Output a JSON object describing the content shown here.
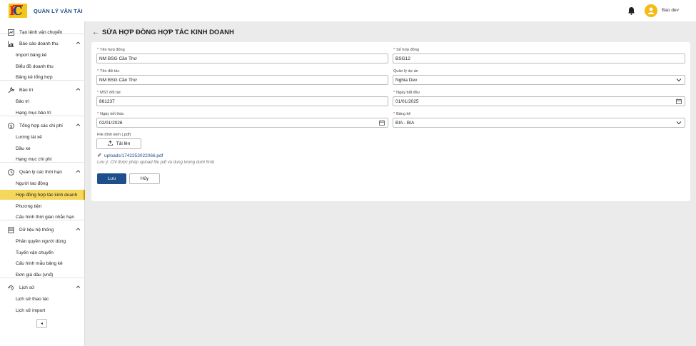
{
  "header": {
    "app_title": "QUẢN LÝ VẬN TẢI",
    "user_name": "Bao dev"
  },
  "sidebar": {
    "items": [
      {
        "type": "group",
        "label": "Tạo lệnh vận chuyển",
        "icon": "new-order-icon",
        "chevron": ""
      },
      {
        "type": "group",
        "label": "Báo cáo doanh thu",
        "icon": "bar-chart-icon",
        "chevron": "^"
      },
      {
        "type": "sub",
        "label": "Import bảng kê"
      },
      {
        "type": "sub",
        "label": "Biểu đồ doanh thu"
      },
      {
        "type": "sub",
        "label": "Bảng kê tổng hợp"
      },
      {
        "type": "group",
        "label": "Bảo trì",
        "icon": "wrench-icon",
        "chevron": "^"
      },
      {
        "type": "sub",
        "label": "Bảo trì"
      },
      {
        "type": "sub",
        "label": "Hạng mục bảo trì"
      },
      {
        "type": "group",
        "label": "Tổng hợp các chi phí",
        "icon": "dollar-icon",
        "chevron": "^"
      },
      {
        "type": "sub",
        "label": "Lương tài xế"
      },
      {
        "type": "sub",
        "label": "Dầu xe"
      },
      {
        "type": "sub",
        "label": "Hạng mục chi phí"
      },
      {
        "type": "group",
        "label": "Quản lý các thời hạn",
        "icon": "clock-icon",
        "chevron": "^"
      },
      {
        "type": "sub",
        "label": "Người lao động"
      },
      {
        "type": "sub",
        "label": "Hợp đồng hợp tác kinh doanh",
        "active": true
      },
      {
        "type": "sub",
        "label": "Phương tiện"
      },
      {
        "type": "sub",
        "label": "Cấu hình thời gian nhắc hạn"
      },
      {
        "type": "group",
        "label": "Dữ liệu hệ thống",
        "icon": "database-icon",
        "chevron": "^"
      },
      {
        "type": "sub",
        "label": "Phân quyền người dùng"
      },
      {
        "type": "sub",
        "label": "Tuyến vận chuyển"
      },
      {
        "type": "sub",
        "label": "Cấu hình mẫu bảng kê"
      },
      {
        "type": "sub",
        "label": "Đơn giá dầu (vnđ)"
      },
      {
        "type": "group",
        "label": "Lịch sử",
        "icon": "history-icon",
        "chevron": "^"
      },
      {
        "type": "sub",
        "label": "Lịch sử thao tác"
      },
      {
        "type": "sub",
        "label": "Lịch sử import"
      }
    ],
    "collapse_glyph": "◂"
  },
  "page": {
    "back_glyph": "←",
    "title": "SỬA HỢP ĐỒNG HỢP TÁC KINH DOANH"
  },
  "form": {
    "contract_name": {
      "label": "Tên hợp đồng",
      "value": "NM BSG Cần Thơ"
    },
    "contract_number": {
      "label": "Số hợp đồng",
      "value": "BSG12"
    },
    "partner_name": {
      "label": "Tên đối tác",
      "value": "NM BSG Cần Thơ"
    },
    "project_manager": {
      "label": "Quản lý dự án",
      "value": "Nghia Dev"
    },
    "partner_tax": {
      "label": "MST đối tác",
      "value": "861237"
    },
    "start_date": {
      "label": "Ngày bắt đầu",
      "value": "01/01/2025"
    },
    "end_date": {
      "label": "Ngày kết thúc",
      "value": "02/01/2026"
    },
    "statement": {
      "label": "Bảng kê",
      "value": "BIA - BIA"
    },
    "attachment_label": "File đính kèm (.pdf)",
    "upload_label": "Tải lên",
    "attachment_file": "uploads/1742353022066.pdf",
    "note": "Lưu ý: Chỉ được phép upload file pdf và dung lượng dưới 5mb",
    "save_label": "Lưu",
    "cancel_label": "Hủy"
  },
  "colors": {
    "brand": "#1f4e8c",
    "active_menu": "#f5d75c",
    "avatar": "#f5b914",
    "required": "#e02424"
  }
}
